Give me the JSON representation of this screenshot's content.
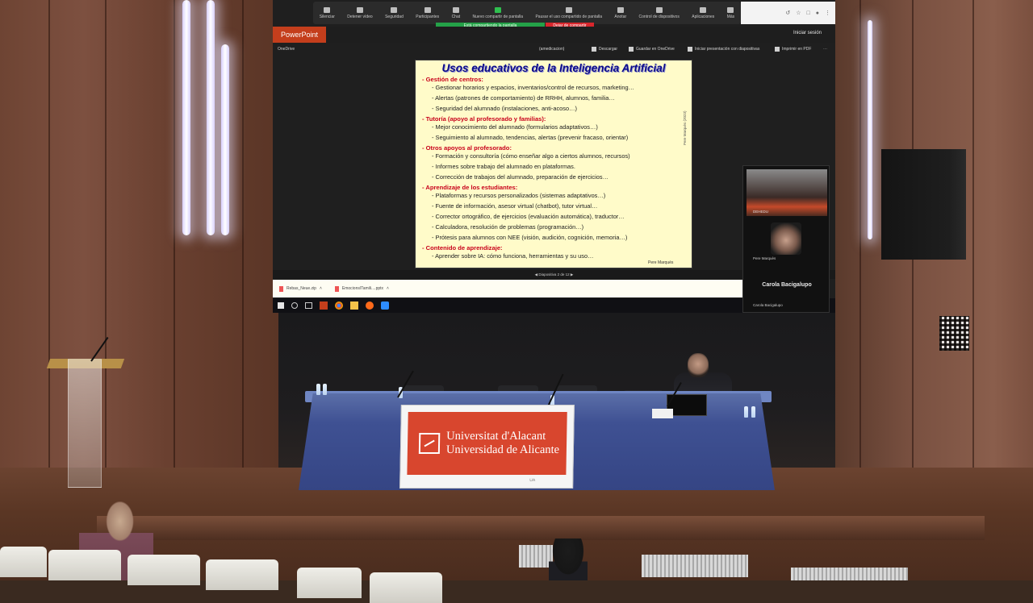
{
  "zoom": {
    "toolbar": [
      {
        "label": "Silenciar",
        "icon": "microphone-icon"
      },
      {
        "label": "Detener vídeo",
        "icon": "video-camera-icon"
      },
      {
        "label": "Seguridad",
        "icon": "shield-icon"
      },
      {
        "label": "Participantes",
        "icon": "participants-icon"
      },
      {
        "label": "Chat",
        "icon": "chat-icon"
      },
      {
        "label": "Nuevo compartir de pantalla",
        "icon": "share-screen-icon"
      },
      {
        "label": "Pausar el uso compartido de pantalla",
        "icon": "pause-icon"
      },
      {
        "label": "Anotar",
        "icon": "annotate-icon"
      },
      {
        "label": "Control de dispositivos",
        "icon": "remote-control-icon"
      },
      {
        "label": "Aplicaciones",
        "icon": "apps-icon"
      },
      {
        "label": "Más",
        "icon": "more-icon"
      }
    ],
    "share_banner": "Está compartiendo la pantalla",
    "stop_share": "Dejar de compartir",
    "participants": [
      {
        "name": "DEHEDU",
        "role": "room-camera"
      },
      {
        "name": "Pere Marquès",
        "role": "speaker"
      },
      {
        "name": "Carola Bacigalupo",
        "role": "active-display-name"
      },
      {
        "name": "Carola Bacigalupo",
        "role": "label"
      }
    ]
  },
  "powerpoint": {
    "brand": "PowerPoint",
    "signin": "Iniciar sesión",
    "location": "OneDrive",
    "file": "(amedicacion)",
    "tools": [
      "Descargar",
      "Guardar en OneDrive",
      "Iniciar presentación con diapositivas",
      "Imprimir en PDF"
    ],
    "status": "Diapositiva 2 de 12",
    "brand_color": "#c43e1c"
  },
  "slide": {
    "title": "Usos educativos de la Inteligencia Artificial",
    "sections": [
      {
        "heading": "- Gestión de centros:",
        "items": [
          "- Gestionar horarios y espacios, inventarios/control de recursos, marketing…",
          "- Alertas (patrones de comportamiento) de RRHH, alumnos, familia…",
          "- Seguridad del alumnado (instalaciones, anti-acoso…)"
        ]
      },
      {
        "heading": "- Tutoría (apoyo al profesorado y familias):",
        "items": [
          "- Mejor conocimiento del alumnado (formularios adaptativos…)",
          "- Seguimiento al alumnado, tendencias, alertas (prevenir fracaso, orientar)"
        ]
      },
      {
        "heading": "- Otros apoyos al profesorado:",
        "items": [
          "- Formación y consultoría (cómo enseñar algo a ciertos alumnos, recursos)",
          "- Informes sobre trabajo del alumnado en plataformas.",
          "- Corrección de trabajos del alumnado, preparación de ejercicios…"
        ]
      },
      {
        "heading": "- Aprendizaje de los estudiantes:",
        "items": [
          "- Plataformas y recursos personalizados (sistemas adaptativos…)",
          "- Fuente de información, asesor virtual (chatbot), tutor virtual…",
          "- Corrector ortográfico, de ejercicios (evaluación automática), traductor…",
          "- Calculadora, resolución de problemas (programación…)",
          "- Prótesis para alumnos con NEE (visión, audición, cognición, memoria…)"
        ]
      },
      {
        "heading": "- Contenido de aprendizaje:",
        "items": [
          "- Aprender sobre IA: cómo funciona, herramientas y su uso…"
        ]
      }
    ],
    "side_credit": "Pere Marquès (2023)",
    "credit": "Pere Marquès",
    "heading_color": "#c8001a",
    "title_color": "#0a0a8a",
    "background": "#fffbc9"
  },
  "downloads": [
    {
      "name": "Rebas_Neue.zip"
    },
    {
      "name": "EmocionsITamili....pptx"
    }
  ],
  "venue": {
    "banner_line1": "Universitat d'Alacant",
    "banner_line2": "Universidad de Alicante",
    "banner_color": "#d8462e",
    "banner_foot": "UA"
  }
}
